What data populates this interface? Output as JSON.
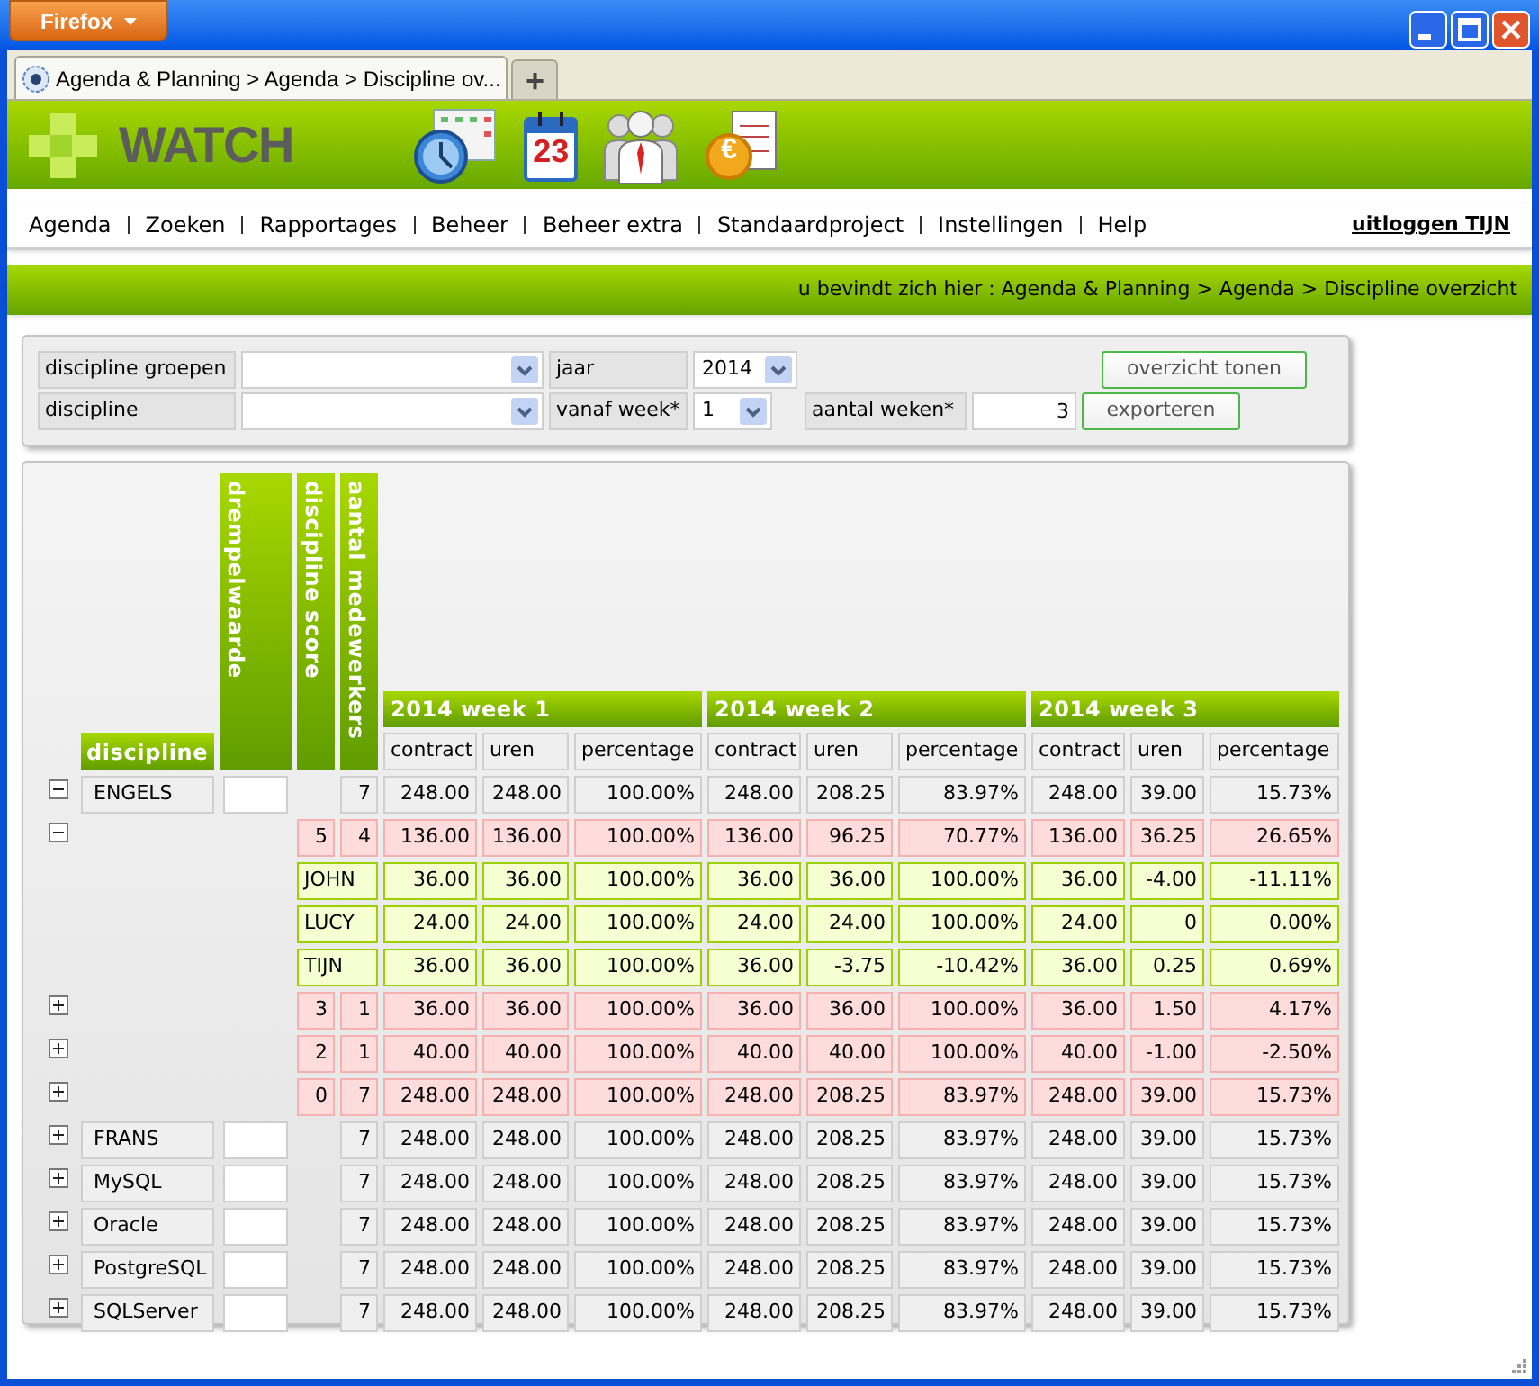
{
  "window": {
    "app_button": "Firefox"
  },
  "browser_tabs": [
    {
      "label": "Agenda & Planning > Agenda > Discipline ov...",
      "selected": true
    }
  ],
  "new_tab": "+",
  "header": {
    "logo_text": "WATCH",
    "calendar_day": "23",
    "coin_symbol": "€"
  },
  "nav": {
    "items": [
      "Agenda",
      "Zoeken",
      "Rapportages",
      "Beheer",
      "Beheer extra",
      "Standaardproject",
      "Instellingen",
      "Help"
    ],
    "logout": "uitloggen TIJN"
  },
  "breadcrumb": "u bevindt zich hier : Agenda & Planning > Agenda > Discipline overzicht",
  "filters": {
    "group_label": "discipline groepen",
    "discipline_label": "discipline",
    "year_label": "jaar",
    "year_value": "2014",
    "week_label": "vanaf week*",
    "week_value": "1",
    "count_label": "aantal weken*",
    "count_value": "3",
    "buttons": [
      "overzicht tonen",
      "exporteren"
    ]
  },
  "table": {
    "discipline_header": "discipline",
    "vertical_headers": [
      "drempelwaarde",
      "discipline score",
      "aantal medewerkers"
    ],
    "weeks": [
      {
        "title": "2014 week 1",
        "columns": [
          "contract",
          "uren",
          "percentage"
        ]
      },
      {
        "title": "2014 week 2",
        "columns": [
          "contract",
          "uren",
          "percentage"
        ]
      },
      {
        "title": "2014 week 3",
        "columns": [
          "contract",
          "uren",
          "percentage"
        ]
      }
    ],
    "rows": [
      {
        "kind": "group",
        "expanded": true,
        "discipline": "ENGELS",
        "count": "7",
        "values": [
          "248.00",
          "248.00",
          "100.00%",
          "248.00",
          "208.25",
          "83.97%",
          "248.00",
          "39.00",
          "15.73%"
        ]
      },
      {
        "kind": "score",
        "expanded": true,
        "score": "5",
        "count": "4",
        "values": [
          "136.00",
          "136.00",
          "100.00%",
          "136.00",
          "96.25",
          "70.77%",
          "136.00",
          "36.25",
          "26.65%"
        ]
      },
      {
        "kind": "person",
        "name": "JOHN",
        "values": [
          "36.00",
          "36.00",
          "100.00%",
          "36.00",
          "36.00",
          "100.00%",
          "36.00",
          "-4.00",
          "-11.11%"
        ]
      },
      {
        "kind": "person",
        "name": "LUCY",
        "values": [
          "24.00",
          "24.00",
          "100.00%",
          "24.00",
          "24.00",
          "100.00%",
          "24.00",
          "0",
          "0.00%"
        ]
      },
      {
        "kind": "person",
        "name": "TIJN",
        "values": [
          "36.00",
          "36.00",
          "100.00%",
          "36.00",
          "-3.75",
          "-10.42%",
          "36.00",
          "0.25",
          "0.69%"
        ]
      },
      {
        "kind": "score",
        "expanded": false,
        "score": "3",
        "count": "1",
        "values": [
          "36.00",
          "36.00",
          "100.00%",
          "36.00",
          "36.00",
          "100.00%",
          "36.00",
          "1.50",
          "4.17%"
        ]
      },
      {
        "kind": "score",
        "expanded": false,
        "score": "2",
        "count": "1",
        "values": [
          "40.00",
          "40.00",
          "100.00%",
          "40.00",
          "40.00",
          "100.00%",
          "40.00",
          "-1.00",
          "-2.50%"
        ]
      },
      {
        "kind": "score",
        "expanded": false,
        "score": "0",
        "count": "7",
        "values": [
          "248.00",
          "248.00",
          "100.00%",
          "248.00",
          "208.25",
          "83.97%",
          "248.00",
          "39.00",
          "15.73%"
        ]
      },
      {
        "kind": "group",
        "expanded": false,
        "discipline": "FRANS",
        "count": "7",
        "values": [
          "248.00",
          "248.00",
          "100.00%",
          "248.00",
          "208.25",
          "83.97%",
          "248.00",
          "39.00",
          "15.73%"
        ]
      },
      {
        "kind": "group",
        "expanded": false,
        "discipline": "MySQL",
        "count": "7",
        "values": [
          "248.00",
          "248.00",
          "100.00%",
          "248.00",
          "208.25",
          "83.97%",
          "248.00",
          "39.00",
          "15.73%"
        ]
      },
      {
        "kind": "group",
        "expanded": false,
        "discipline": "Oracle",
        "count": "7",
        "values": [
          "248.00",
          "248.00",
          "100.00%",
          "248.00",
          "208.25",
          "83.97%",
          "248.00",
          "39.00",
          "15.73%"
        ]
      },
      {
        "kind": "group",
        "expanded": false,
        "discipline": "PostgreSQL",
        "count": "7",
        "values": [
          "248.00",
          "248.00",
          "100.00%",
          "248.00",
          "208.25",
          "83.97%",
          "248.00",
          "39.00",
          "15.73%"
        ]
      },
      {
        "kind": "group",
        "expanded": false,
        "discipline": "SQLServer",
        "count": "7",
        "values": [
          "248.00",
          "248.00",
          "100.00%",
          "248.00",
          "208.25",
          "83.97%",
          "248.00",
          "39.00",
          "15.73%"
        ]
      }
    ]
  }
}
